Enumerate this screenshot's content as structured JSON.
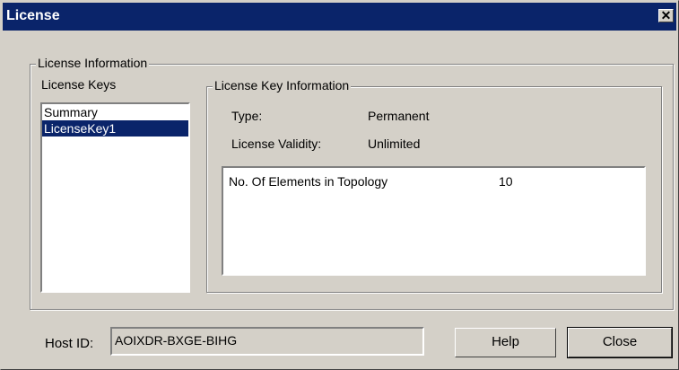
{
  "window": {
    "title": "License",
    "close_glyph": "✕"
  },
  "license_info": {
    "group_label": "License Information",
    "keys_label": "License Keys",
    "keys": [
      {
        "label": "Summary",
        "selected": false
      },
      {
        "label": "LicenseKey1",
        "selected": true
      }
    ]
  },
  "key_info": {
    "group_label": "License Key Information",
    "type_label": "Type:",
    "type_value": "Permanent",
    "validity_label": "License Validity:",
    "validity_value": "Unlimited",
    "details": [
      {
        "name": "No. Of Elements in Topology",
        "value": "10"
      }
    ]
  },
  "footer": {
    "host_label": "Host ID:",
    "host_value": "AOIXDR-BXGE-BIHG",
    "help_label": "Help",
    "close_label": "Close"
  }
}
